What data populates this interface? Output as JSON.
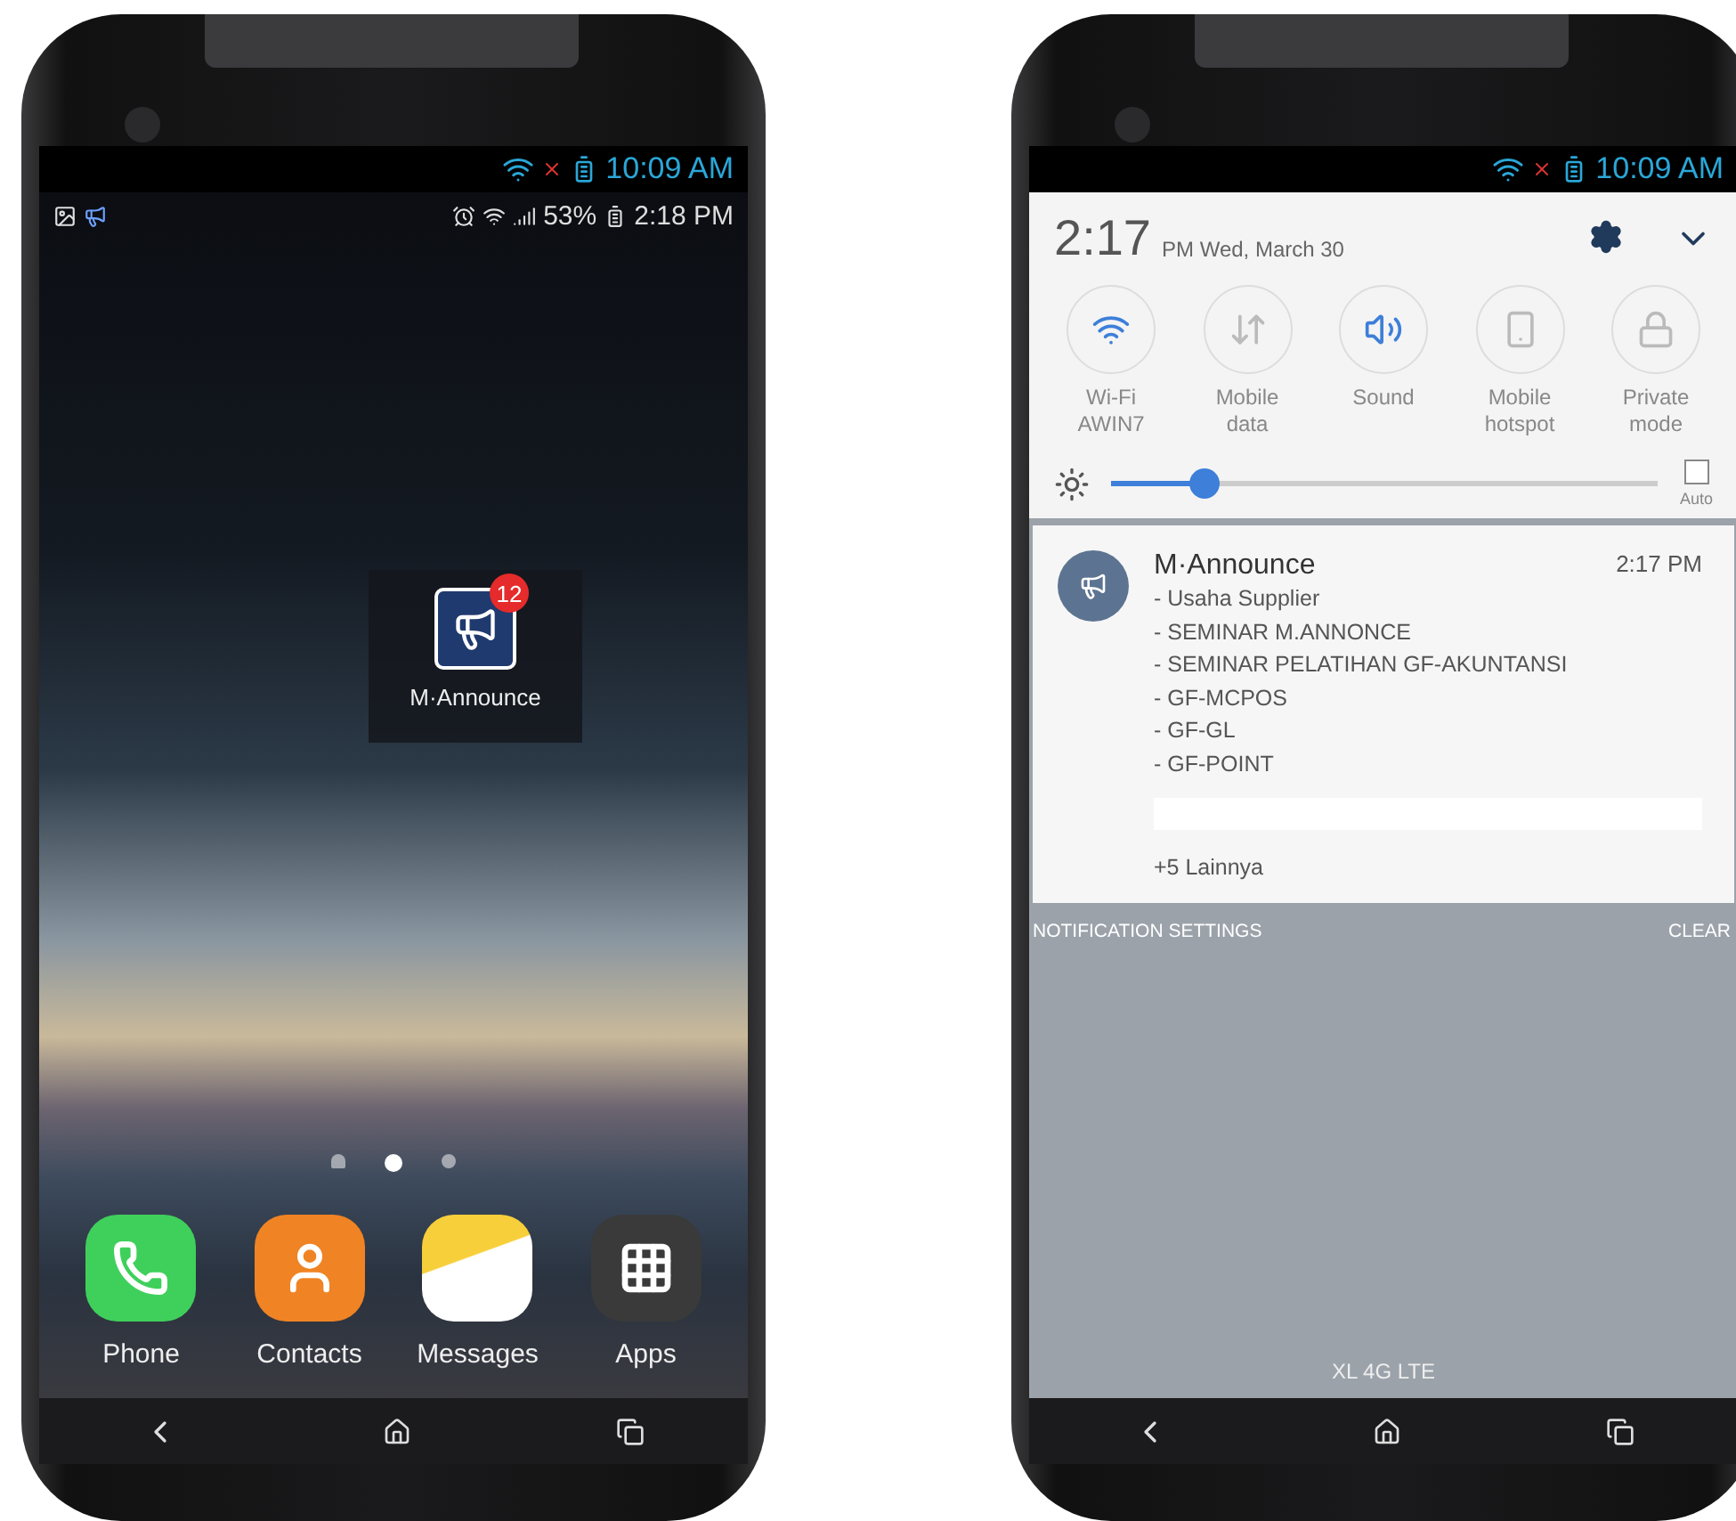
{
  "phones": [
    {
      "kind": "home",
      "outer_status": {
        "time": "10:09 AM"
      },
      "status_bar": {
        "battery": "53%",
        "time": "2:18 PM"
      },
      "app_icon": {
        "label": "M·Announce",
        "badge": "12"
      },
      "page_dots": [
        {
          "kind": "home",
          "selected": false
        },
        {
          "kind": "dot",
          "selected": true
        },
        {
          "kind": "dot",
          "selected": false
        }
      ],
      "dock": [
        {
          "kind": "phone",
          "label": "Phone"
        },
        {
          "kind": "contacts",
          "label": "Contacts"
        },
        {
          "kind": "messages",
          "label": "Messages"
        },
        {
          "kind": "apps",
          "label": "Apps"
        }
      ]
    },
    {
      "kind": "notifications",
      "outer_status": {
        "time": "10:09 AM"
      },
      "header": {
        "time": "2:17",
        "ampm_date": "PM Wed, March 30"
      },
      "toggles": [
        {
          "kind": "wifi",
          "label": "Wi-Fi",
          "sublabel": "AWIN7",
          "on": true
        },
        {
          "kind": "data",
          "label": "Mobile",
          "sublabel": "data",
          "on": false
        },
        {
          "kind": "sound",
          "label": "Sound",
          "on": true
        },
        {
          "kind": "hotspot",
          "label": "Mobile",
          "sublabel": "hotspot",
          "on": false
        },
        {
          "kind": "private",
          "label": "Private",
          "sublabel": "mode",
          "on": false
        }
      ],
      "brightness": {
        "level": 0.17,
        "auto_label": "Auto",
        "auto_checked": false
      },
      "notification": {
        "title": "M·Announce",
        "time": "2:17 PM",
        "lines": [
          "- Usaha Supplier",
          "- SEMINAR M.ANNONCE",
          "- SEMINAR PELATIHAN GF-AKUNTANSI",
          "- GF-MCPOS",
          "- GF-GL",
          "- GF-POINT"
        ],
        "more": "+5 Lainnya"
      },
      "footer": {
        "settings": "NOTIFICATION SETTINGS",
        "clear": "CLEAR"
      },
      "carrier": "XL 4G LTE"
    }
  ]
}
